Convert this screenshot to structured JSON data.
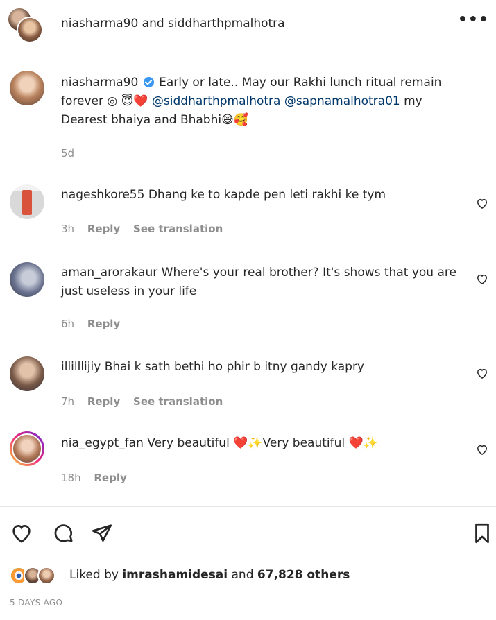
{
  "header": {
    "title": "niasharma90 and siddharthpmalhotra",
    "more_icon": "more-horizontal-icon"
  },
  "caption": {
    "username": "niasharma90",
    "text_1": "Early or late.. May our Rakhi lunch ritual remain forever",
    "emoji_1": "◎ 😇❤️",
    "mention_1": "@siddharthpmalhotra",
    "mention_2": "@sapnamalhotra01",
    "text_2": "my Dearest bhaiya and Bhabhi",
    "emoji_2": "😅🥰",
    "time": "5d"
  },
  "comments": [
    {
      "username": "nageshkore55",
      "text": "Dhang ke to kapde pen leti rakhi ke tym",
      "time": "3h",
      "reply": "Reply",
      "translation": "See translation"
    },
    {
      "username": "aman_arorakaur",
      "text": "Where's your real brother? It's shows that you are just useless in your life",
      "time": "6h",
      "reply": "Reply"
    },
    {
      "username": "illilllijiy",
      "text": "Bhai k sath bethi ho phir b itny gandy kapry",
      "time": "7h",
      "reply": "Reply",
      "translation": "See translation"
    },
    {
      "username": "nia_egypt_fan",
      "text_a": "Very beautiful",
      "emoji_a": "❤️✨",
      "text_b": "Very beautiful",
      "emoji_b": "❤️✨",
      "time": "18h",
      "reply": "Reply"
    }
  ],
  "likes": {
    "prefix": "Liked by",
    "user": "imrashamidesai",
    "middle": "and",
    "count": "67,828 others"
  },
  "posted": "5 DAYS AGO",
  "colors": {
    "text": "#262626",
    "secondary": "#8e8e8e",
    "mention": "#00376b",
    "verified": "#3897f0"
  }
}
